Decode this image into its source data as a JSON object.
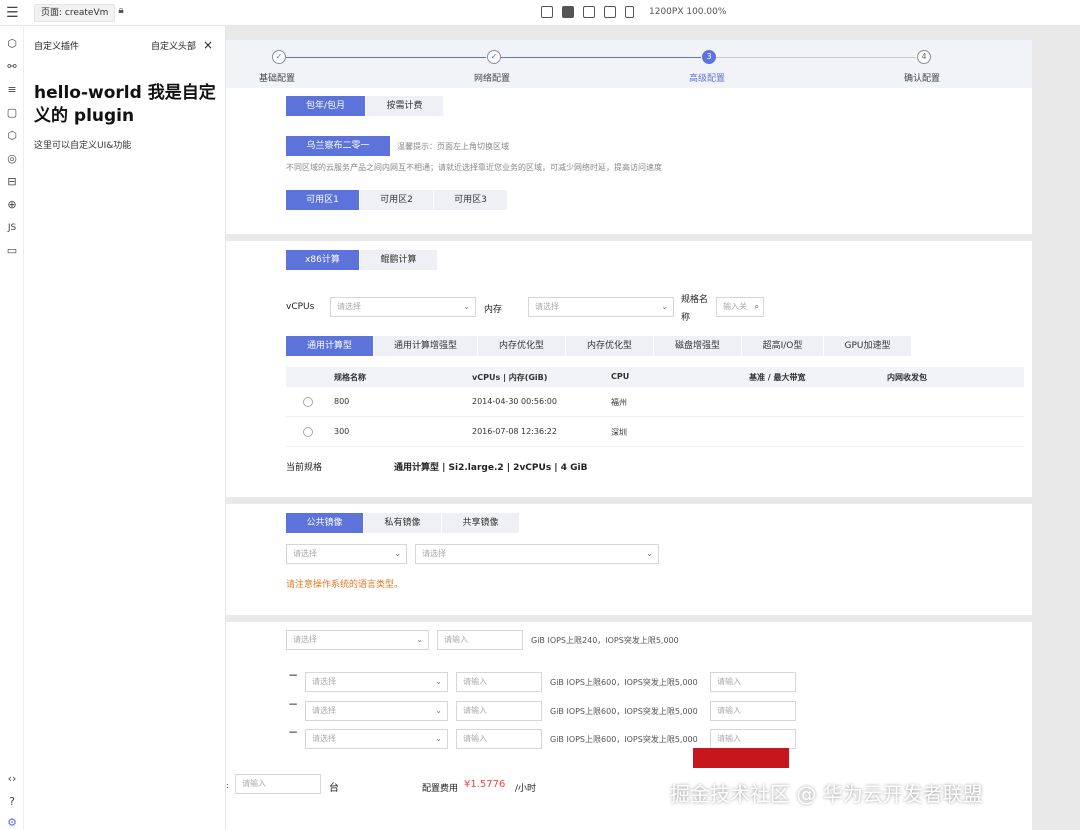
{
  "topbar": {
    "page_label": "页面: createVm",
    "zoom_label": "1200PX  100.00%"
  },
  "plugin": {
    "title": "自定义插件",
    "header_link": "自定义头部",
    "close": "×",
    "hello": "hello-world 我是自定义的 plugin",
    "desc": "这里可以自定义UI&功能"
  },
  "leftbar": {
    "js_label": "JS"
  },
  "steps": [
    {
      "label": "基础配置",
      "num": "✓",
      "state": "done"
    },
    {
      "label": "网络配置",
      "num": "✓",
      "state": "done"
    },
    {
      "label": "高级配置",
      "num": "3",
      "state": "current"
    },
    {
      "label": "确认配置",
      "num": "4",
      "state": "todo"
    }
  ],
  "billing": {
    "tabs": [
      "包年/包月",
      "按需计费"
    ]
  },
  "region": {
    "button": "乌兰察布二零一",
    "tip": "温馨提示：页面左上角切换区域",
    "note": "不同区域的云服务产品之间内网互不相通；请就近选择靠近您业务的区域，可减少网络时延，提高访问速度"
  },
  "zones": [
    "可用区1",
    "可用区2",
    "可用区3"
  ],
  "compute": {
    "arch_tabs": [
      "x86计算",
      "鲲鹏计算"
    ],
    "vcpus_label": "vCPUs",
    "vcpus_placeholder": "请选择",
    "memory_label": "内存",
    "memory_placeholder": "请选择",
    "spec_name_label": "规格名称",
    "spec_placeholder": "输入关",
    "type_tabs": [
      "通用计算型",
      "通用计算增强型",
      "内存优化型",
      "内存优化型",
      "磁盘增强型",
      "超高I/O型",
      "GPU加速型"
    ],
    "table": {
      "headers": [
        "规格名称",
        "vCPUs | 内存(GiB)",
        "CPU",
        "基准 / 最大带宽",
        "内网收发包"
      ],
      "rows": [
        {
          "name": "800",
          "spec": "2014-04-30 00:56:00",
          "cpu": "福州"
        },
        {
          "name": "300",
          "spec": "2016-07-08 12:36:22",
          "cpu": "深圳"
        }
      ]
    },
    "current_label": "当前规格",
    "current_value": "通用计算型 | Si2.large.2 | 2vCPUs | 4 GiB"
  },
  "image": {
    "tabs": [
      "公共镜像",
      "私有镜像",
      "共享镜像"
    ],
    "select1_placeholder": "请选择",
    "select2_placeholder": "请选择",
    "warning": "请注意操作系统的语言类型。"
  },
  "disk": {
    "system": {
      "select_placeholder": "请选择",
      "input_placeholder": "请输入",
      "note": "GiB IOPS上限240，IOPS突发上限5,000"
    },
    "data": [
      {
        "minus": "−",
        "select_placeholder": "请选择",
        "input_placeholder": "请输入",
        "note": "GiB IOPS上限600，IOPS突发上限5,000",
        "extra_placeholder": "请输入"
      },
      {
        "minus": "−",
        "select_placeholder": "请选择",
        "input_placeholder": "请输入",
        "note": "GiB IOPS上限600，IOPS突发上限5,000",
        "extra_placeholder": "请输入"
      },
      {
        "minus": "−",
        "select_placeholder": "请选择",
        "input_placeholder": "请输入",
        "note": "GiB IOPS上限600，IOPS突发上限5,000",
        "extra_placeholder": "请输入"
      }
    ]
  },
  "footer": {
    "colon": ":",
    "qty_placeholder": "请输入",
    "unit": "台",
    "fee_label": "配置费用",
    "price": "¥1.5776",
    "per": "/小时"
  },
  "watermark": "掘金技术社区 @ 华为云开发者联盟"
}
